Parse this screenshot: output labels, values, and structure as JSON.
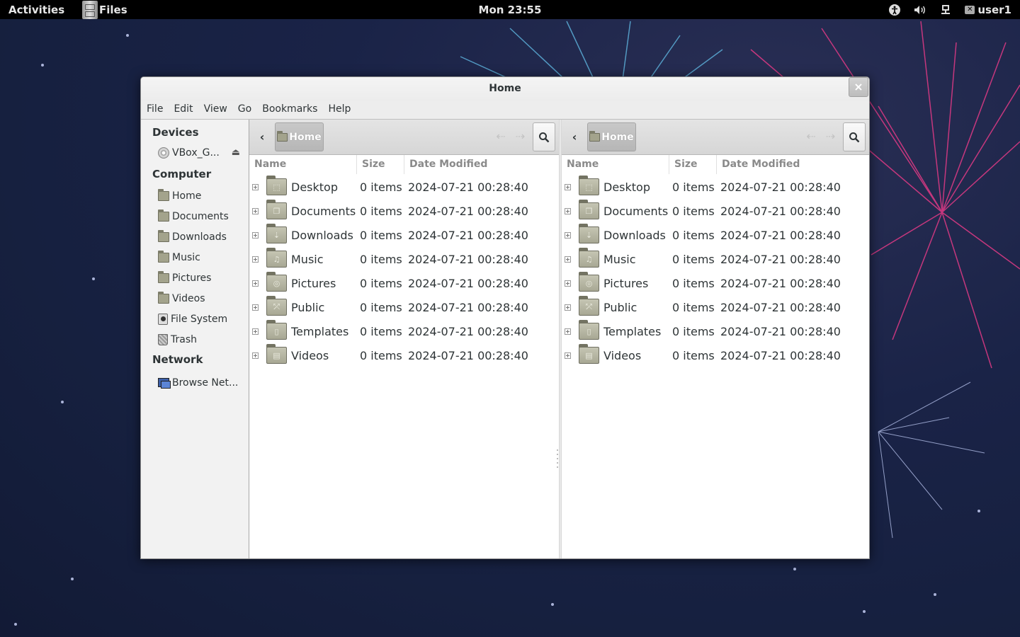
{
  "topbar": {
    "activities": "Activities",
    "app_name": "Files",
    "clock": "Mon 23:55",
    "user": "user1",
    "tray_icons": [
      "accessibility-icon",
      "volume-icon",
      "network-icon",
      "chat-icon"
    ]
  },
  "window": {
    "title": "Home",
    "close_label": "×"
  },
  "menubar": [
    "File",
    "Edit",
    "View",
    "Go",
    "Bookmarks",
    "Help"
  ],
  "sidebar": {
    "sections": [
      {
        "header": "Devices",
        "items": [
          {
            "label": "VBox_G...",
            "icon": "disc-icon",
            "eject": true
          }
        ]
      },
      {
        "header": "Computer",
        "items": [
          {
            "label": "Home",
            "icon": "home-folder-icon"
          },
          {
            "label": "Documents",
            "icon": "documents-folder-icon"
          },
          {
            "label": "Downloads",
            "icon": "downloads-folder-icon"
          },
          {
            "label": "Music",
            "icon": "music-folder-icon"
          },
          {
            "label": "Pictures",
            "icon": "pictures-folder-icon"
          },
          {
            "label": "Videos",
            "icon": "videos-folder-icon"
          },
          {
            "label": "File System",
            "icon": "filesystem-icon"
          },
          {
            "label": "Trash",
            "icon": "trash-icon"
          }
        ]
      },
      {
        "header": "Network",
        "items": [
          {
            "label": "Browse Net...",
            "icon": "network-browse-icon"
          }
        ]
      }
    ]
  },
  "panes": [
    {
      "location": "Home",
      "columns": [
        "Name",
        "Size",
        "Date Modified"
      ],
      "rows": [
        {
          "name": "Desktop",
          "size": "0 items",
          "date": "2024-07-21 00:28:40",
          "glyph": "⬚"
        },
        {
          "name": "Documents",
          "size": "0 items",
          "date": "2024-07-21 00:28:40",
          "glyph": "❐"
        },
        {
          "name": "Downloads",
          "size": "0 items",
          "date": "2024-07-21 00:28:40",
          "glyph": "⇣"
        },
        {
          "name": "Music",
          "size": "0 items",
          "date": "2024-07-21 00:28:40",
          "glyph": "♫"
        },
        {
          "name": "Pictures",
          "size": "0 items",
          "date": "2024-07-21 00:28:40",
          "glyph": "◎"
        },
        {
          "name": "Public",
          "size": "0 items",
          "date": "2024-07-21 00:28:40",
          "glyph": "⤱"
        },
        {
          "name": "Templates",
          "size": "0 items",
          "date": "2024-07-21 00:28:40",
          "glyph": "▯"
        },
        {
          "name": "Videos",
          "size": "0 items",
          "date": "2024-07-21 00:28:40",
          "glyph": "▤"
        }
      ]
    },
    {
      "location": "Home",
      "columns": [
        "Name",
        "Size",
        "Date Modified"
      ],
      "rows": [
        {
          "name": "Desktop",
          "size": "0 items",
          "date": "2024-07-21 00:28:40",
          "glyph": "⬚"
        },
        {
          "name": "Documents",
          "size": "0 items",
          "date": "2024-07-21 00:28:40",
          "glyph": "❐"
        },
        {
          "name": "Downloads",
          "size": "0 items",
          "date": "2024-07-21 00:28:40",
          "glyph": "⇣"
        },
        {
          "name": "Music",
          "size": "0 items",
          "date": "2024-07-21 00:28:40",
          "glyph": "♫"
        },
        {
          "name": "Pictures",
          "size": "0 items",
          "date": "2024-07-21 00:28:40",
          "glyph": "◎"
        },
        {
          "name": "Public",
          "size": "0 items",
          "date": "2024-07-21 00:28:40",
          "glyph": "⤱"
        },
        {
          "name": "Templates",
          "size": "0 items",
          "date": "2024-07-21 00:28:40",
          "glyph": "▯"
        },
        {
          "name": "Videos",
          "size": "0 items",
          "date": "2024-07-21 00:28:40",
          "glyph": "▤"
        }
      ]
    }
  ],
  "toolbar": {
    "back_glyph": "‹",
    "history_back_glyph": "⇠",
    "history_forward_glyph": "⇢"
  }
}
